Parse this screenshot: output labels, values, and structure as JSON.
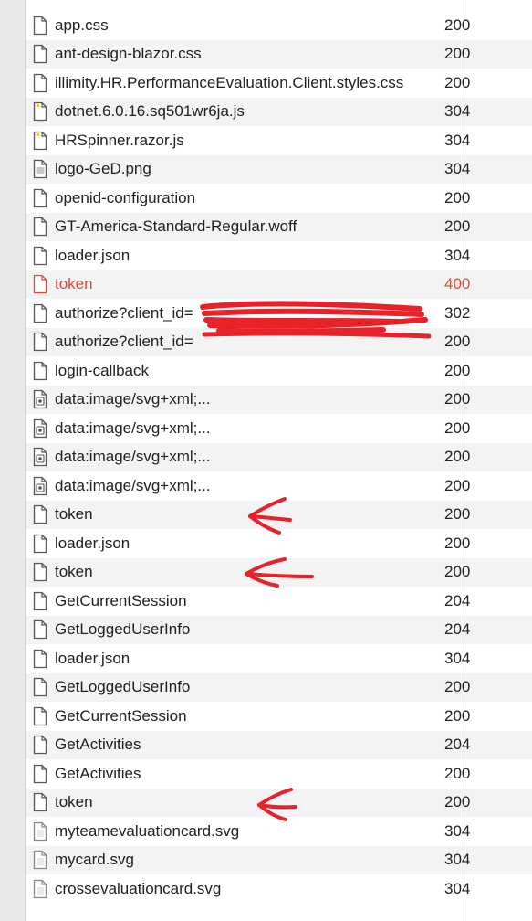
{
  "rows": [
    {
      "name": "app.css",
      "status": "200",
      "icon": "file-icon"
    },
    {
      "name": "ant-design-blazor.css",
      "status": "200",
      "icon": "file-icon"
    },
    {
      "name": "illimity.HR.PerformanceEvaluation.Client.styles.css",
      "status": "200",
      "icon": "file-icon"
    },
    {
      "name": "dotnet.6.0.16.sq501wr6ja.js",
      "status": "304",
      "icon": "script-file-icon"
    },
    {
      "name": "HRSpinner.razor.js",
      "status": "304",
      "icon": "script-file-icon"
    },
    {
      "name": "logo-GeD.png",
      "status": "304",
      "icon": "image-file-icon"
    },
    {
      "name": "openid-configuration",
      "status": "200",
      "icon": "file-icon"
    },
    {
      "name": "GT-America-Standard-Regular.woff",
      "status": "200",
      "icon": "file-icon"
    },
    {
      "name": "loader.json",
      "status": "304",
      "icon": "file-icon"
    },
    {
      "name": "token",
      "status": "400",
      "icon": "error-file-icon",
      "error": true
    },
    {
      "name": "authorize?client_id=",
      "status": "302",
      "icon": "file-icon"
    },
    {
      "name": "authorize?client_id=",
      "status": "200",
      "icon": "file-icon"
    },
    {
      "name": "login-callback",
      "status": "200",
      "icon": "file-icon"
    },
    {
      "name": "data:image/svg+xml;...",
      "status": "200",
      "icon": "svg-file-icon"
    },
    {
      "name": "data:image/svg+xml;...",
      "status": "200",
      "icon": "svg-file-icon"
    },
    {
      "name": "data:image/svg+xml;...",
      "status": "200",
      "icon": "svg-file-icon"
    },
    {
      "name": "data:image/svg+xml;...",
      "status": "200",
      "icon": "svg-file-icon"
    },
    {
      "name": "token",
      "status": "200",
      "icon": "file-icon"
    },
    {
      "name": "loader.json",
      "status": "200",
      "icon": "file-icon"
    },
    {
      "name": "token",
      "status": "200",
      "icon": "file-icon"
    },
    {
      "name": "GetCurrentSession",
      "status": "204",
      "icon": "file-icon"
    },
    {
      "name": "GetLoggedUserInfo",
      "status": "204",
      "icon": "file-icon"
    },
    {
      "name": "loader.json",
      "status": "304",
      "icon": "file-icon"
    },
    {
      "name": "GetLoggedUserInfo",
      "status": "200",
      "icon": "file-icon"
    },
    {
      "name": "GetCurrentSession",
      "status": "200",
      "icon": "file-icon"
    },
    {
      "name": "GetActivities",
      "status": "204",
      "icon": "file-icon"
    },
    {
      "name": "GetActivities",
      "status": "200",
      "icon": "file-icon"
    },
    {
      "name": "token",
      "status": "200",
      "icon": "file-icon"
    },
    {
      "name": "myteamevaluationcard.svg",
      "status": "304",
      "icon": "svg-image-icon"
    },
    {
      "name": "mycard.svg",
      "status": "304",
      "icon": "svg-image-icon"
    },
    {
      "name": "crossevaluationcard.svg",
      "status": "304",
      "icon": "svg-image-icon"
    }
  ],
  "colors": {
    "error": "#e0483e",
    "annotation": "#e8222a",
    "row_alt": "#f3f3f3"
  }
}
